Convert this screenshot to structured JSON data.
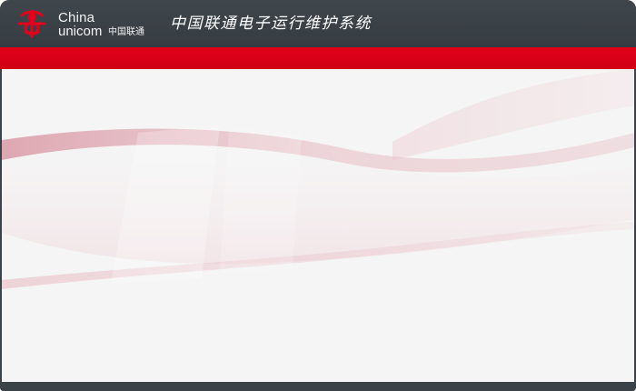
{
  "header": {
    "logo": {
      "text_latin_1": "China",
      "text_latin_2": "unicom",
      "text_cn": "中国联通",
      "icon": "china-unicom-logo-icon"
    },
    "app_title": "中国联通电子运行维护系统"
  },
  "colors": {
    "titlebar": "#3b4248",
    "accent_red": "#e2001a",
    "content_bg": "#f5f5f5",
    "wave": "#d9a3ad"
  }
}
